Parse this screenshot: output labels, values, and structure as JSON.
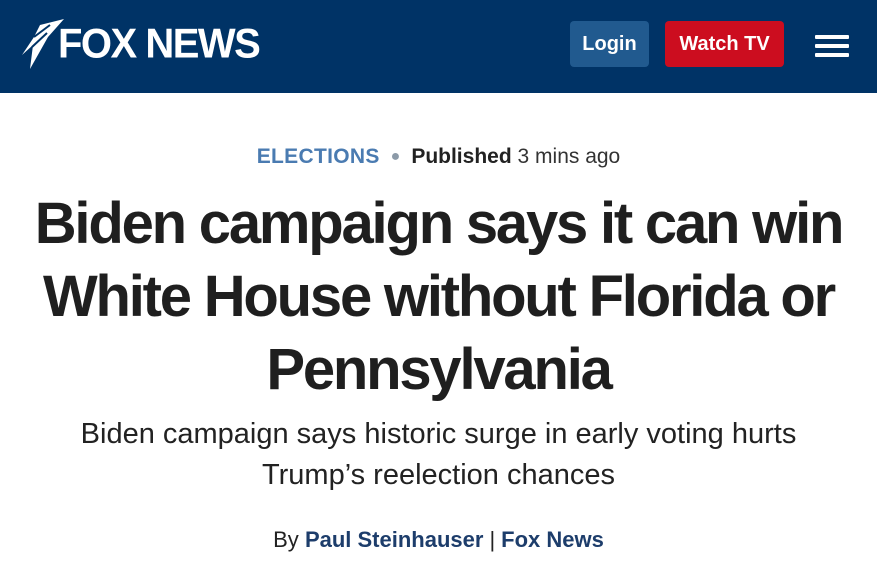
{
  "header": {
    "logo_text": "FOX NEWS",
    "login_label": "Login",
    "watch_label": "Watch TV"
  },
  "article": {
    "category": "ELECTIONS",
    "published_label": "Published",
    "published_time": "3 mins ago",
    "headline_lines": [
      "Biden campaign says it can win",
      "White House without Florida or",
      "Pennsylvania"
    ],
    "subhead_lines": [
      "Biden campaign says historic surge in early voting hurts",
      "Trump’s reelection chances"
    ],
    "byline_prefix": "By",
    "author": "Paul Steinhauser",
    "separator": "|",
    "source": "Fox News"
  },
  "colors": {
    "header_bg": "#003366",
    "login_bg": "#215a8f",
    "watch_bg": "#cc0d1f",
    "category": "#4a7bb1",
    "link": "#1d3d6b"
  },
  "icons": {
    "logo": "fox-searchlight-icon",
    "menu": "hamburger-menu-icon"
  }
}
